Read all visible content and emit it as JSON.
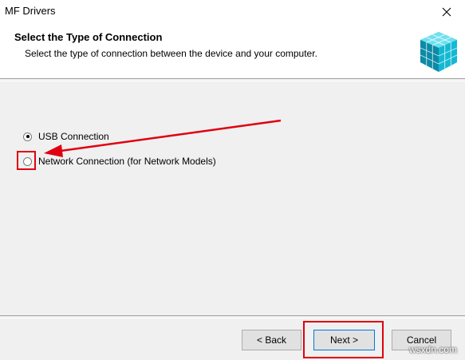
{
  "window": {
    "title": "MF Drivers",
    "close_icon": "close-icon"
  },
  "header": {
    "title": "Select the Type of Connection",
    "description": "Select the type of connection between the device and your computer.",
    "logo_icon": "install-cube-icon"
  },
  "options": [
    {
      "label": "USB Connection",
      "selected": true
    },
    {
      "label": "Network Connection (for Network Models)",
      "selected": false
    }
  ],
  "buttons": {
    "back": "< Back",
    "next": "Next >",
    "cancel": "Cancel"
  },
  "annotations": {
    "highlight_color": "#e00010"
  },
  "watermark": "wsxdn.com"
}
